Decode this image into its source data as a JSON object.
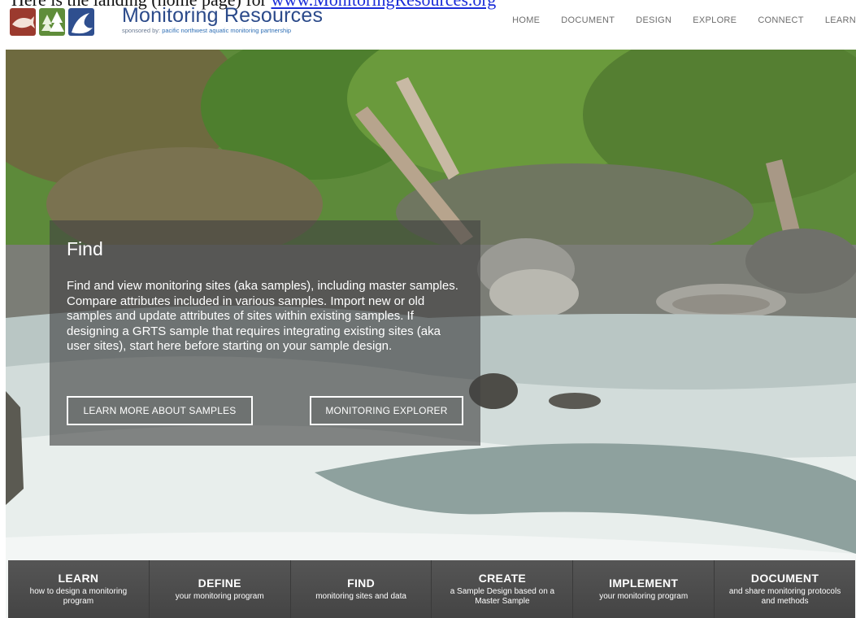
{
  "caption": {
    "text": "Here is the landing (home page) for",
    "link_text": "www.MonitoringResources.org"
  },
  "header": {
    "title": "Monitoring Resources",
    "sponsor_prefix": "sponsored by:",
    "sponsor_link": "pacific northwest aquatic monitoring partnership"
  },
  "nav": [
    "HOME",
    "DOCUMENT",
    "DESIGN",
    "EXPLORE",
    "CONNECT",
    "LEARN"
  ],
  "hero": {
    "heading": "Find",
    "body": "Find and view monitoring sites (aka samples), including master samples. Compare attributes included in various samples. Import new or old samples and update attributes of sites within existing samples. If designing a GRTS sample that requires integrating existing sites (aka user sites), start here before starting on your sample design.",
    "button_left": "LEARN MORE ABOUT SAMPLES",
    "button_right": "MONITORING EXPLORER"
  },
  "steps": [
    {
      "title": "LEARN",
      "sub": "how to design a monitoring program"
    },
    {
      "title": "DEFINE",
      "sub": "your monitoring program"
    },
    {
      "title": "FIND",
      "sub": "monitoring sites and data"
    },
    {
      "title": "CREATE",
      "sub": "a Sample Design based on a Master Sample"
    },
    {
      "title": "IMPLEMENT",
      "sub": "your monitoring program"
    },
    {
      "title": "DOCUMENT",
      "sub": "and share monitoring protocols and methods"
    }
  ],
  "colors": {
    "brand": "#2b4a8a",
    "nav_text": "#6d6d6d",
    "step_bar": "#4a4a4a",
    "panel": "rgba(65,65,65,0.62)"
  }
}
